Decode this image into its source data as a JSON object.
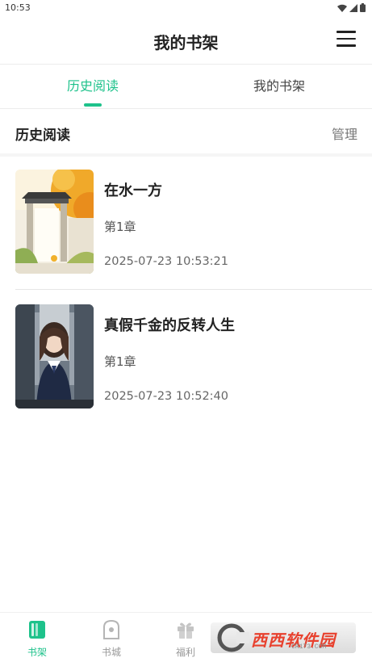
{
  "status_bar": {
    "time": "10:53",
    "icons": [
      "wifi-icon",
      "signal-icon",
      "battery-icon"
    ]
  },
  "header": {
    "title": "我的书架",
    "menu_icon": "menu-icon"
  },
  "tabs": [
    {
      "label": "历史阅读",
      "active": true
    },
    {
      "label": "我的书架",
      "active": false
    }
  ],
  "section": {
    "title": "历史阅读",
    "manage_label": "管理"
  },
  "books": [
    {
      "title": "在水一方",
      "chapter": "第1章",
      "last_read": "2025-07-23 10:53:21"
    },
    {
      "title": "真假千金的反转人生",
      "chapter": "第1章",
      "last_read": "2025-07-23 10:52:40"
    }
  ],
  "bottom_nav": [
    {
      "label": "书架",
      "icon": "bookshelf-icon",
      "active": true
    },
    {
      "label": "书城",
      "icon": "bookstore-icon",
      "active": false
    },
    {
      "label": "福利",
      "icon": "gift-icon",
      "active": false
    }
  ],
  "watermark": {
    "text": "西西软件园",
    "sub": "CR173.COM"
  },
  "colors": {
    "accent": "#1ec28b",
    "watermark": "#e8412e"
  }
}
